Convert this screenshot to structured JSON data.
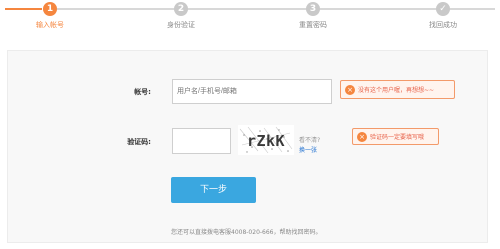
{
  "steps": [
    {
      "number": "1",
      "label": "输入帐号",
      "state": "active"
    },
    {
      "number": "2",
      "label": "身份验证",
      "state": "inactive"
    },
    {
      "number": "3",
      "label": "重置密码",
      "state": "inactive"
    },
    {
      "number": "✓",
      "label": "找回成功",
      "state": "inactive"
    }
  ],
  "form": {
    "account_label": "帐号:",
    "account_placeholder": "用户名/手机号/邮箱",
    "account_error": "没有这个用户喔，再想想~~",
    "captcha_label": "验证码:",
    "captcha_value": "",
    "captcha_text": "rZkK",
    "captcha_hint": "看不清?",
    "captcha_refresh": "换一张",
    "captcha_error": "验证码一定要填写哦",
    "next_button": "下一步"
  },
  "footer": {
    "text": "您还可以直接拨电客服4008-020-666，帮助找回密码。"
  },
  "colors": {
    "accent": "#f5863f",
    "button": "#3aa7e0",
    "error_text": "#e8624a",
    "link": "#1e6fd0"
  }
}
